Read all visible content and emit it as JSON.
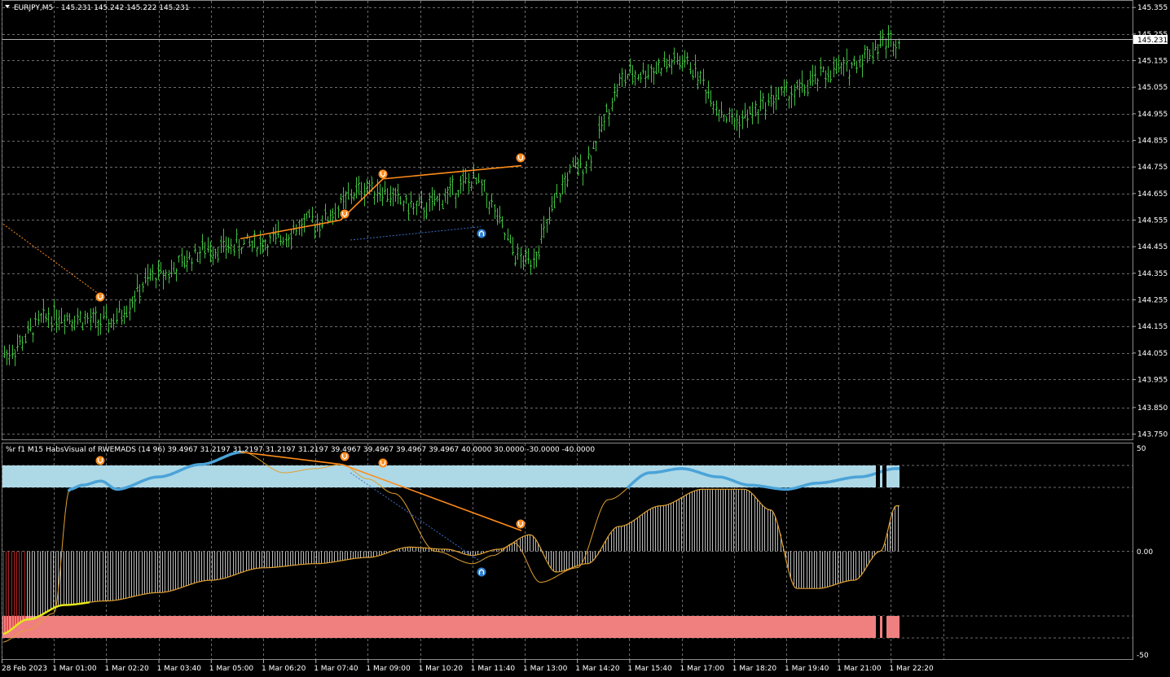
{
  "header": {
    "symbol": "EURJPY,M5",
    "ohlc": "145.231 145.242 145.222 145.231"
  },
  "price_axis": [
    "145.355",
    "145.255",
    "145.155",
    "145.055",
    "144.955",
    "144.855",
    "144.755",
    "144.655",
    "144.555",
    "144.455",
    "144.355",
    "144.255",
    "144.155",
    "144.055",
    "143.955",
    "143.850",
    "143.750"
  ],
  "current_price": "145.231",
  "indicator": {
    "header": "%r f1 M15 HabsVisual of RWEMADS (14 96) 39.4967 31.2197 31.2197 31.2197 31.2197 39.4967 39.4967 39.4967 39.4967 40.0000 30.0000 -30.0000 -40.0000",
    "axis": [
      "50",
      "0.00",
      "-50"
    ]
  },
  "time_axis": [
    "28 Feb 2023",
    "1 Mar 01:00",
    "1 Mar 02:20",
    "1 Mar 03:40",
    "1 Mar 05:00",
    "1 Mar 06:20",
    "1 Mar 07:40",
    "1 Mar 09:00",
    "1 Mar 10:20",
    "1 Mar 11:40",
    "1 Mar 13:00",
    "1 Mar 14:20",
    "1 Mar 15:40",
    "1 Mar 17:00",
    "1 Mar 18:20",
    "1 Mar 19:40",
    "1 Mar 21:00",
    "1 Mar 22:20"
  ],
  "colors": {
    "background": "#000000",
    "grid": "#6b6b6b",
    "bar": "#3fbf3f",
    "divergence": "#ff8c1a",
    "hidden_divergence": "#3d6ec9",
    "overbought_zone": "#add8e6",
    "oversold_zone": "#f08080",
    "signal_line": "#e0a030",
    "main_line": "#4aa3d8",
    "arrow_down": "#ff8c1a",
    "arrow_up": "#2f7fd0"
  },
  "chart_data": {
    "type": "ohlc",
    "symbol": "EURJPY",
    "timeframe": "M5",
    "anchor_points": [
      {
        "time": "28 Feb 2023",
        "price": 144.05
      },
      {
        "time": "1 Mar 01:00",
        "price": 144.2
      },
      {
        "time": "1 Mar 02:20",
        "price": 144.17
      },
      {
        "time": "1 Mar 03:40",
        "price": 144.35
      },
      {
        "time": "1 Mar 05:00",
        "price": 144.45
      },
      {
        "time": "1 Mar 06:20",
        "price": 144.47
      },
      {
        "time": "1 Mar 07:40",
        "price": 144.55
      },
      {
        "time": "1 Mar 09:00",
        "price": 144.68
      },
      {
        "time": "1 Mar 10:20",
        "price": 144.6
      },
      {
        "time": "1 Mar 11:40",
        "price": 144.7
      },
      {
        "time": "1 Mar 13:00",
        "price": 144.4
      },
      {
        "time": "1 Mar 14:20",
        "price": 144.75
      },
      {
        "time": "1 Mar 15:40",
        "price": 145.1
      },
      {
        "time": "1 Mar 17:00",
        "price": 145.15
      },
      {
        "time": "1 Mar 18:20",
        "price": 144.93
      },
      {
        "time": "1 Mar 19:40",
        "price": 145.03
      },
      {
        "time": "1 Mar 21:00",
        "price": 145.12
      },
      {
        "time": "1 Mar 22:20",
        "price": 145.231
      }
    ],
    "ylim": [
      143.73,
      145.38
    ],
    "oscillator": {
      "ylim": [
        -50,
        50
      ],
      "levels": [
        40,
        30,
        -30,
        -40
      ]
    }
  }
}
